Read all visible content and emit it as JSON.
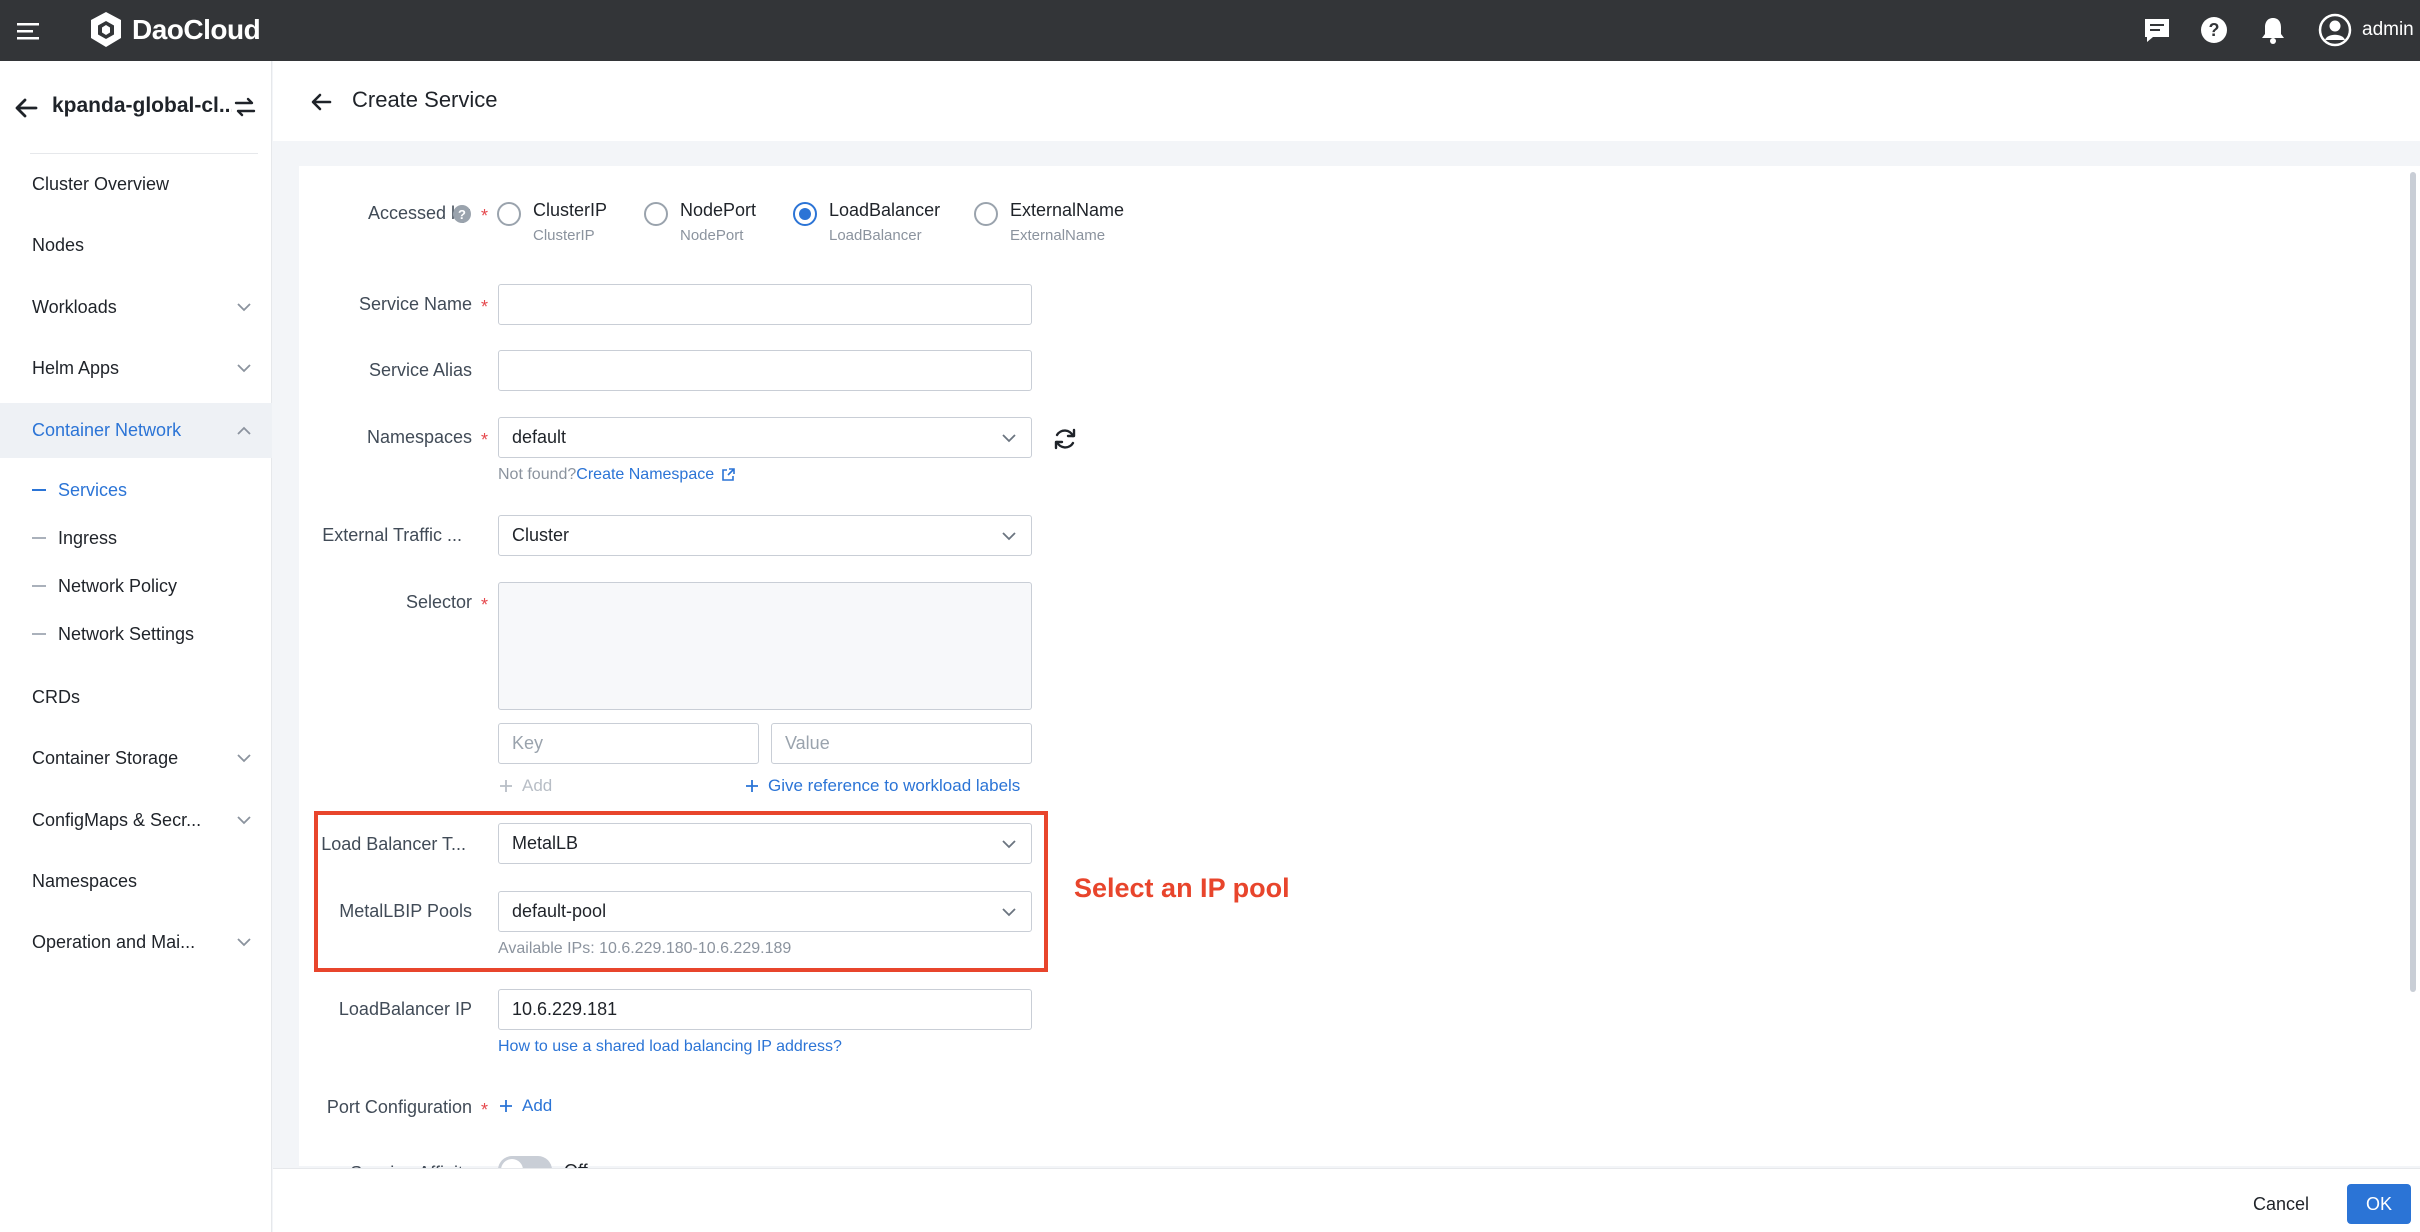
{
  "topbar": {
    "brand": "DaoCloud",
    "user": "admin",
    "icons": [
      "menu-icon",
      "message-icon",
      "help-icon",
      "bell-icon",
      "user-avatar-icon"
    ]
  },
  "sidebar": {
    "cluster_name": "kpanda-global-cl...",
    "items": [
      {
        "label": "Cluster Overview"
      },
      {
        "label": "Nodes"
      },
      {
        "label": "Workloads"
      },
      {
        "label": "Helm Apps"
      },
      {
        "label": "Container Network"
      },
      {
        "label": "CRDs"
      },
      {
        "label": "Container Storage"
      },
      {
        "label": "ConfigMaps & Secr..."
      },
      {
        "label": "Namespaces"
      },
      {
        "label": "Operation and Mai..."
      }
    ],
    "subitems": [
      {
        "label": "Services"
      },
      {
        "label": "Ingress"
      },
      {
        "label": "Network Policy"
      },
      {
        "label": "Network Settings"
      }
    ]
  },
  "page": {
    "title": "Create Service"
  },
  "form": {
    "accessed_by": {
      "label": "Accessed by",
      "options": [
        {
          "main": "ClusterIP",
          "sub": "ClusterIP"
        },
        {
          "main": "NodePort",
          "sub": "NodePort"
        },
        {
          "main": "LoadBalancer",
          "sub": "LoadBalancer"
        },
        {
          "main": "ExternalName",
          "sub": "ExternalName"
        }
      ],
      "selected": "LoadBalancer"
    },
    "service_name": {
      "label": "Service Name",
      "value": ""
    },
    "service_alias": {
      "label": "Service Alias",
      "value": ""
    },
    "namespaces": {
      "label": "Namespaces",
      "value": "default",
      "not_found": "Not found?",
      "create_link": "Create Namespace"
    },
    "external_traffic": {
      "label": "External Traffic ...",
      "value": "Cluster"
    },
    "selector": {
      "label": "Selector",
      "key_placeholder": "Key",
      "value_placeholder": "Value",
      "add": "Add",
      "reference": "Give reference to workload labels"
    },
    "lb_type": {
      "label": "Load Balancer T...",
      "value": "MetalLB"
    },
    "ip_pools": {
      "label": "MetalLBIP Pools",
      "value": "default-pool",
      "hint": "Available IPs: 10.6.229.180-10.6.229.189"
    },
    "lb_ip": {
      "label": "LoadBalancer IP",
      "value": "10.6.229.181",
      "help_link": "How to use a shared load balancing IP address?"
    },
    "port_config": {
      "label": "Port Configuration",
      "add": "Add"
    },
    "session_affinity": {
      "label": "Session Affinity",
      "state": "Off"
    }
  },
  "annotation": "Select an IP pool",
  "footer": {
    "cancel": "Cancel",
    "ok": "OK"
  },
  "colors": {
    "accent": "#2b74d6",
    "annotation": "#e8452c",
    "topbar": "#333538"
  }
}
